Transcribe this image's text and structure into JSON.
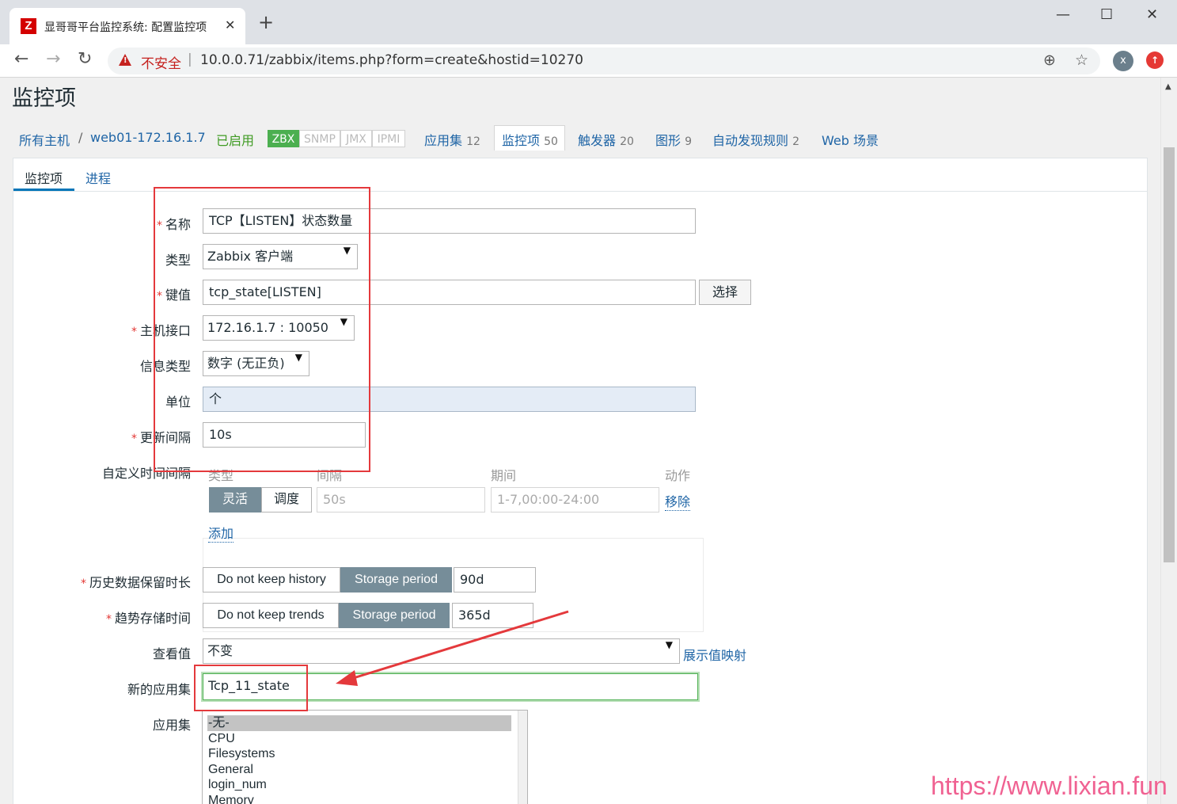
{
  "browser": {
    "tab_title": "显哥哥平台监控系统: 配置监控项",
    "favicon_letter": "Z",
    "tab_close": "✕",
    "new_tab": "+",
    "security_label": "不安全",
    "separator": "|",
    "url": "10.0.0.71/zabbix/items.php?form=create&hostid=10270",
    "profile_initial": "x",
    "window_controls": {
      "minimize": "—",
      "maximize": "☐",
      "close": "✕"
    },
    "icons": {
      "back": "arrow-left-icon",
      "forward": "arrow-right-icon",
      "reload": "reload-icon",
      "zoom": "zoom-icon",
      "star": "star-icon"
    }
  },
  "page": {
    "title": "监控项"
  },
  "breadcrumb": {
    "all_hosts": "所有主机",
    "sep": "/",
    "host": "web01-172.16.1.7",
    "status": "已启用",
    "availability": [
      "ZBX",
      "SNMP",
      "JMX",
      "IPMI"
    ],
    "links": [
      {
        "label": "应用集",
        "count": "12"
      },
      {
        "label": "监控项",
        "count": "50"
      },
      {
        "label": "触发器",
        "count": "20"
      },
      {
        "label": "图形",
        "count": "9"
      },
      {
        "label": "自动发现规则",
        "count": "2"
      },
      {
        "label": "Web 场景",
        "count": ""
      }
    ]
  },
  "form_tabs": [
    "监控项",
    "进程"
  ],
  "form": {
    "name_label": "名称",
    "name_value": "TCP【LISTEN】状态数量",
    "type_label": "类型",
    "type_value": "Zabbix 客户端",
    "key_label": "键值",
    "key_value": "tcp_state[LISTEN]",
    "key_select_button": "选择",
    "interface_label": "主机接口",
    "interface_value": "172.16.1.7 : 10050",
    "info_type_label": "信息类型",
    "info_type_value": "数字 (无正负)",
    "units_label": "单位",
    "units_value": "个",
    "interval_label": "更新间隔",
    "interval_value": "10s",
    "custom_intervals_label": "自定义时间间隔",
    "custom_intervals": {
      "headers": [
        "类型",
        "间隔",
        "期间",
        "动作"
      ],
      "mode_flexible": "灵活",
      "mode_scheduling": "调度",
      "interval_placeholder": "50s",
      "period_placeholder": "1-7,00:00-24:00",
      "remove": "移除",
      "add": "添加"
    },
    "history_label": "历史数据保留时长",
    "history_off": "Do not keep history",
    "history_on": "Storage period",
    "history_value": "90d",
    "trends_label": "趋势存储时间",
    "trends_off": "Do not keep trends",
    "trends_on": "Storage period",
    "trends_value": "365d",
    "valuemap_label": "查看值",
    "valuemap_value": "不变",
    "valuemap_link": "展示值映射",
    "new_app_label": "新的应用集",
    "new_app_value": "Tcp_11_state",
    "apps_label": "应用集",
    "apps_options": [
      "-无-",
      "CPU",
      "Filesystems",
      "General",
      "login_num",
      "Memory"
    ]
  },
  "watermark": "https://www.lixian.fun",
  "colors": {
    "annotation_red": "#e4393c",
    "link_blue": "#1f65a6",
    "enabled_green": "#3f9b23",
    "segment_active": "#768d99"
  }
}
